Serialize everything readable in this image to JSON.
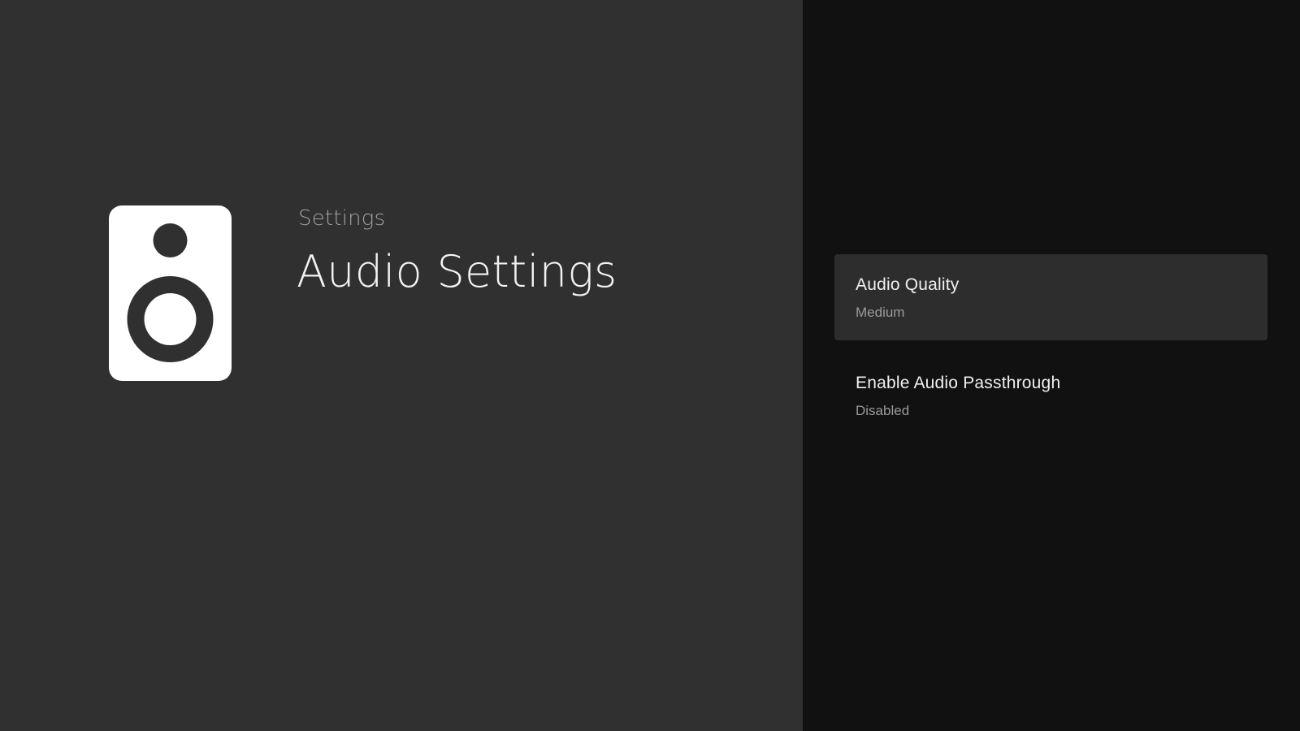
{
  "guidance": {
    "breadcrumb": "Settings",
    "title": "Audio Settings",
    "icon": "speaker-icon"
  },
  "actions": [
    {
      "title": "Audio Quality",
      "description": "Medium",
      "focused": true
    },
    {
      "title": "Enable Audio Passthrough",
      "description": "Disabled",
      "focused": false
    }
  ],
  "colors": {
    "guidance_background": "#303030",
    "actions_background": "#111111",
    "focused_item_background": "#2d2d2d",
    "primary_text": "#f0f0f0",
    "secondary_text": "#9a9a9a"
  }
}
